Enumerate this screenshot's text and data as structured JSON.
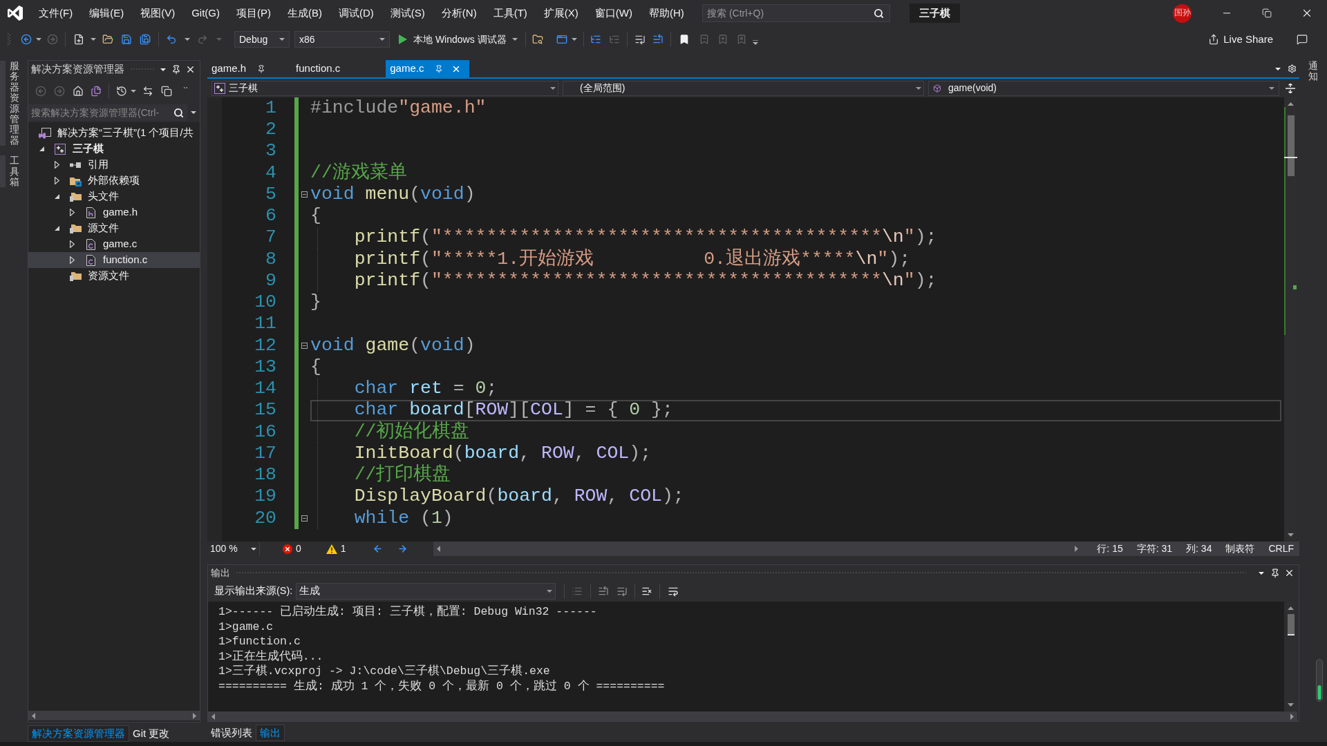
{
  "title_bar": {
    "menu": [
      "文件(F)",
      "编辑(E)",
      "视图(V)",
      "Git(G)",
      "项目(P)",
      "生成(B)",
      "调试(D)",
      "测试(S)",
      "分析(N)",
      "工具(T)",
      "扩展(X)",
      "窗口(W)",
      "帮助(H)"
    ],
    "search": {
      "placeholder": "搜索 (Ctrl+Q)"
    },
    "solution_name": "三子棋",
    "account_initials": "国孙"
  },
  "toolbar": {
    "configuration": "Debug",
    "platform": "x86",
    "start_debugging": "本地 Windows 调试器",
    "live_share": "Live Share"
  },
  "left_side_tabs": [
    "服务器资源管理器",
    "工具箱"
  ],
  "solution_explorer": {
    "title": "解决方案资源管理器",
    "search": {
      "placeholder": "搜索解决方案资源管理器(Ctrl-"
    },
    "tree": [
      {
        "label": "解决方案“三子棋”(1 个项目/共",
        "kind": "solution",
        "selected": false,
        "children": [
          {
            "label": "三子棋",
            "kind": "project",
            "expanded": true,
            "selected": false,
            "children": [
              {
                "label": "引用",
                "kind": "references",
                "expanded": false,
                "selected": false
              },
              {
                "label": "外部依赖项",
                "kind": "external",
                "expanded": false,
                "selected": false
              },
              {
                "label": "头文件",
                "kind": "folder",
                "expanded": true,
                "selected": false,
                "children": [
                  {
                    "label": "game.h",
                    "kind": "header",
                    "expanded": false,
                    "selected": false
                  }
                ]
              },
              {
                "label": "源文件",
                "kind": "folder",
                "expanded": true,
                "selected": false,
                "children": [
                  {
                    "label": "game.c",
                    "kind": "source",
                    "expanded": false,
                    "selected": false
                  },
                  {
                    "label": "function.c",
                    "kind": "source",
                    "expanded": false,
                    "selected": true
                  }
                ]
              },
              {
                "label": "资源文件",
                "kind": "folder",
                "selected": false
              }
            ]
          }
        ]
      }
    ],
    "bottom_tabs": [
      {
        "label": "解决方案资源管理器",
        "selected": true
      },
      {
        "label": "Git 更改",
        "selected": false
      }
    ]
  },
  "editor": {
    "tabs": [
      {
        "label": "game.h",
        "selected": false,
        "pinned": true
      },
      {
        "label": "function.c",
        "selected": false,
        "pinned": false
      },
      {
        "label": "game.c",
        "selected": true,
        "pinned": true
      }
    ],
    "navigation": {
      "project": "三子棋",
      "scope": "(全局范围)",
      "member": "game(void)"
    },
    "lines": [
      {
        "number": "1",
        "changed": true,
        "fold": false,
        "current": false,
        "tokens": [
          {
            "kind": "pre",
            "text": "#include"
          },
          {
            "kind": "str",
            "text": "\"game.h\""
          }
        ]
      },
      {
        "number": "2",
        "changed": true,
        "fold": false,
        "current": false
      },
      {
        "number": "3",
        "changed": true,
        "fold": false,
        "current": false
      },
      {
        "number": "4",
        "changed": true,
        "fold": false,
        "current": false,
        "tokens": [
          {
            "kind": "com",
            "text": "//游戏菜单"
          }
        ]
      },
      {
        "number": "5",
        "changed": true,
        "fold": true,
        "current": false,
        "tokens": [
          {
            "kind": "kw",
            "text": "void "
          },
          {
            "kind": "fn",
            "text": "menu"
          },
          {
            "kind": "pun",
            "text": "("
          },
          {
            "kind": "kw",
            "text": "void"
          },
          {
            "kind": "pun",
            "text": ")"
          }
        ]
      },
      {
        "number": "6",
        "changed": true,
        "fold": false,
        "current": false,
        "tokens": [
          {
            "kind": "pun",
            "text": "{"
          }
        ]
      },
      {
        "number": "7",
        "changed": true,
        "fold": false,
        "current": false,
        "tokens": [
          {
            "kind": "fn",
            "text": "    printf"
          },
          {
            "kind": "pun",
            "text": "("
          },
          {
            "kind": "str",
            "text": "\"****************************************"
          },
          {
            "kind": "esc",
            "text": "\\n"
          },
          {
            "kind": "str",
            "text": "\""
          },
          {
            "kind": "pun",
            "text": ");"
          }
        ]
      },
      {
        "number": "8",
        "changed": true,
        "fold": false,
        "current": false,
        "tokens": [
          {
            "kind": "fn",
            "text": "    printf"
          },
          {
            "kind": "pun",
            "text": "("
          },
          {
            "kind": "str",
            "text": "\"*****1.开始游戏          0.退出游戏*****"
          },
          {
            "kind": "esc",
            "text": "\\n"
          },
          {
            "kind": "str",
            "text": "\""
          },
          {
            "kind": "pun",
            "text": ");"
          }
        ]
      },
      {
        "number": "9",
        "changed": true,
        "fold": false,
        "current": false,
        "tokens": [
          {
            "kind": "fn",
            "text": "    printf"
          },
          {
            "kind": "pun",
            "text": "("
          },
          {
            "kind": "str",
            "text": "\"****************************************"
          },
          {
            "kind": "esc",
            "text": "\\n"
          },
          {
            "kind": "str",
            "text": "\""
          },
          {
            "kind": "pun",
            "text": ");"
          }
        ]
      },
      {
        "number": "10",
        "changed": true,
        "fold": false,
        "current": false,
        "tokens": [
          {
            "kind": "pun",
            "text": "}"
          }
        ]
      },
      {
        "number": "11",
        "changed": true,
        "fold": false,
        "current": false
      },
      {
        "number": "12",
        "changed": true,
        "fold": true,
        "current": false,
        "tokens": [
          {
            "kind": "kw",
            "text": "void "
          },
          {
            "kind": "fn",
            "text": "game"
          },
          {
            "kind": "pun",
            "text": "("
          },
          {
            "kind": "kw",
            "text": "void"
          },
          {
            "kind": "pun",
            "text": ")"
          }
        ]
      },
      {
        "number": "13",
        "changed": true,
        "fold": false,
        "current": false,
        "tokens": [
          {
            "kind": "pun",
            "text": "{"
          }
        ]
      },
      {
        "number": "14",
        "changed": true,
        "fold": false,
        "current": false,
        "tokens": [
          {
            "kind": "kw",
            "text": "    char "
          },
          {
            "kind": "var",
            "text": "ret"
          },
          {
            "kind": "pun",
            "text": " = "
          },
          {
            "kind": "num",
            "text": "0"
          },
          {
            "kind": "pun",
            "text": ";"
          }
        ]
      },
      {
        "number": "15",
        "changed": true,
        "fold": false,
        "current": true,
        "tokens": [
          {
            "kind": "kw",
            "text": "    char "
          },
          {
            "kind": "var",
            "text": "board"
          },
          {
            "kind": "pun",
            "text": "["
          },
          {
            "kind": "mac",
            "text": "ROW"
          },
          {
            "kind": "pun",
            "text": "]["
          },
          {
            "kind": "mac",
            "text": "COL"
          },
          {
            "kind": "pun",
            "text": "] = { "
          },
          {
            "kind": "num",
            "text": "0"
          },
          {
            "kind": "pun",
            "text": " };"
          }
        ]
      },
      {
        "number": "16",
        "changed": true,
        "fold": false,
        "current": false,
        "tokens": [
          {
            "kind": "com",
            "text": "    //初始化棋盘"
          }
        ]
      },
      {
        "number": "17",
        "changed": true,
        "fold": false,
        "current": false,
        "tokens": [
          {
            "kind": "fn",
            "text": "    InitBoard"
          },
          {
            "kind": "pun",
            "text": "("
          },
          {
            "kind": "var",
            "text": "board"
          },
          {
            "kind": "pun",
            "text": ", "
          },
          {
            "kind": "mac",
            "text": "ROW"
          },
          {
            "kind": "pun",
            "text": ", "
          },
          {
            "kind": "mac",
            "text": "COL"
          },
          {
            "kind": "pun",
            "text": ");"
          }
        ]
      },
      {
        "number": "18",
        "changed": true,
        "fold": false,
        "current": false,
        "tokens": [
          {
            "kind": "com",
            "text": "    //打印棋盘"
          }
        ]
      },
      {
        "number": "19",
        "changed": true,
        "fold": false,
        "current": false,
        "tokens": [
          {
            "kind": "fn",
            "text": "    DisplayBoard"
          },
          {
            "kind": "pun",
            "text": "("
          },
          {
            "kind": "var",
            "text": "board"
          },
          {
            "kind": "pun",
            "text": ", "
          },
          {
            "kind": "mac",
            "text": "ROW"
          },
          {
            "kind": "pun",
            "text": ", "
          },
          {
            "kind": "mac",
            "text": "COL"
          },
          {
            "kind": "pun",
            "text": ");"
          }
        ]
      },
      {
        "number": "20",
        "changed": true,
        "fold": true,
        "current": false,
        "tokens": [
          {
            "kind": "kw",
            "text": "    while"
          },
          {
            "kind": "pun",
            "text": " ("
          },
          {
            "kind": "num",
            "text": "1"
          },
          {
            "kind": "pun",
            "text": ")"
          }
        ]
      }
    ],
    "status": {
      "zoom": "100 %",
      "errors": "0",
      "warnings": "1",
      "position": [
        "行: 15",
        "字符: 31",
        "列: 34",
        "制表符",
        "CRLF"
      ]
    }
  },
  "output": {
    "title": "输出",
    "source_label": "显示输出来源(S):",
    "source": "生成",
    "lines": [
      "1>------ 已启动生成: 项目: 三子棋，配置: Debug Win32 ------",
      "1>game.c",
      "1>function.c",
      "1>正在生成代码...",
      "1>三子棋.vcxproj -> J:\\code\\三子棋\\Debug\\三子棋.exe",
      "========== 生成: 成功 1 个，失败 0 个，最新 0 个，跳过 0 个 =========="
    ],
    "bottom_tabs": [
      {
        "label": "错误列表",
        "selected": false
      },
      {
        "label": "输出",
        "selected": true
      }
    ]
  },
  "right_side_tabs": [
    "通知"
  ]
}
